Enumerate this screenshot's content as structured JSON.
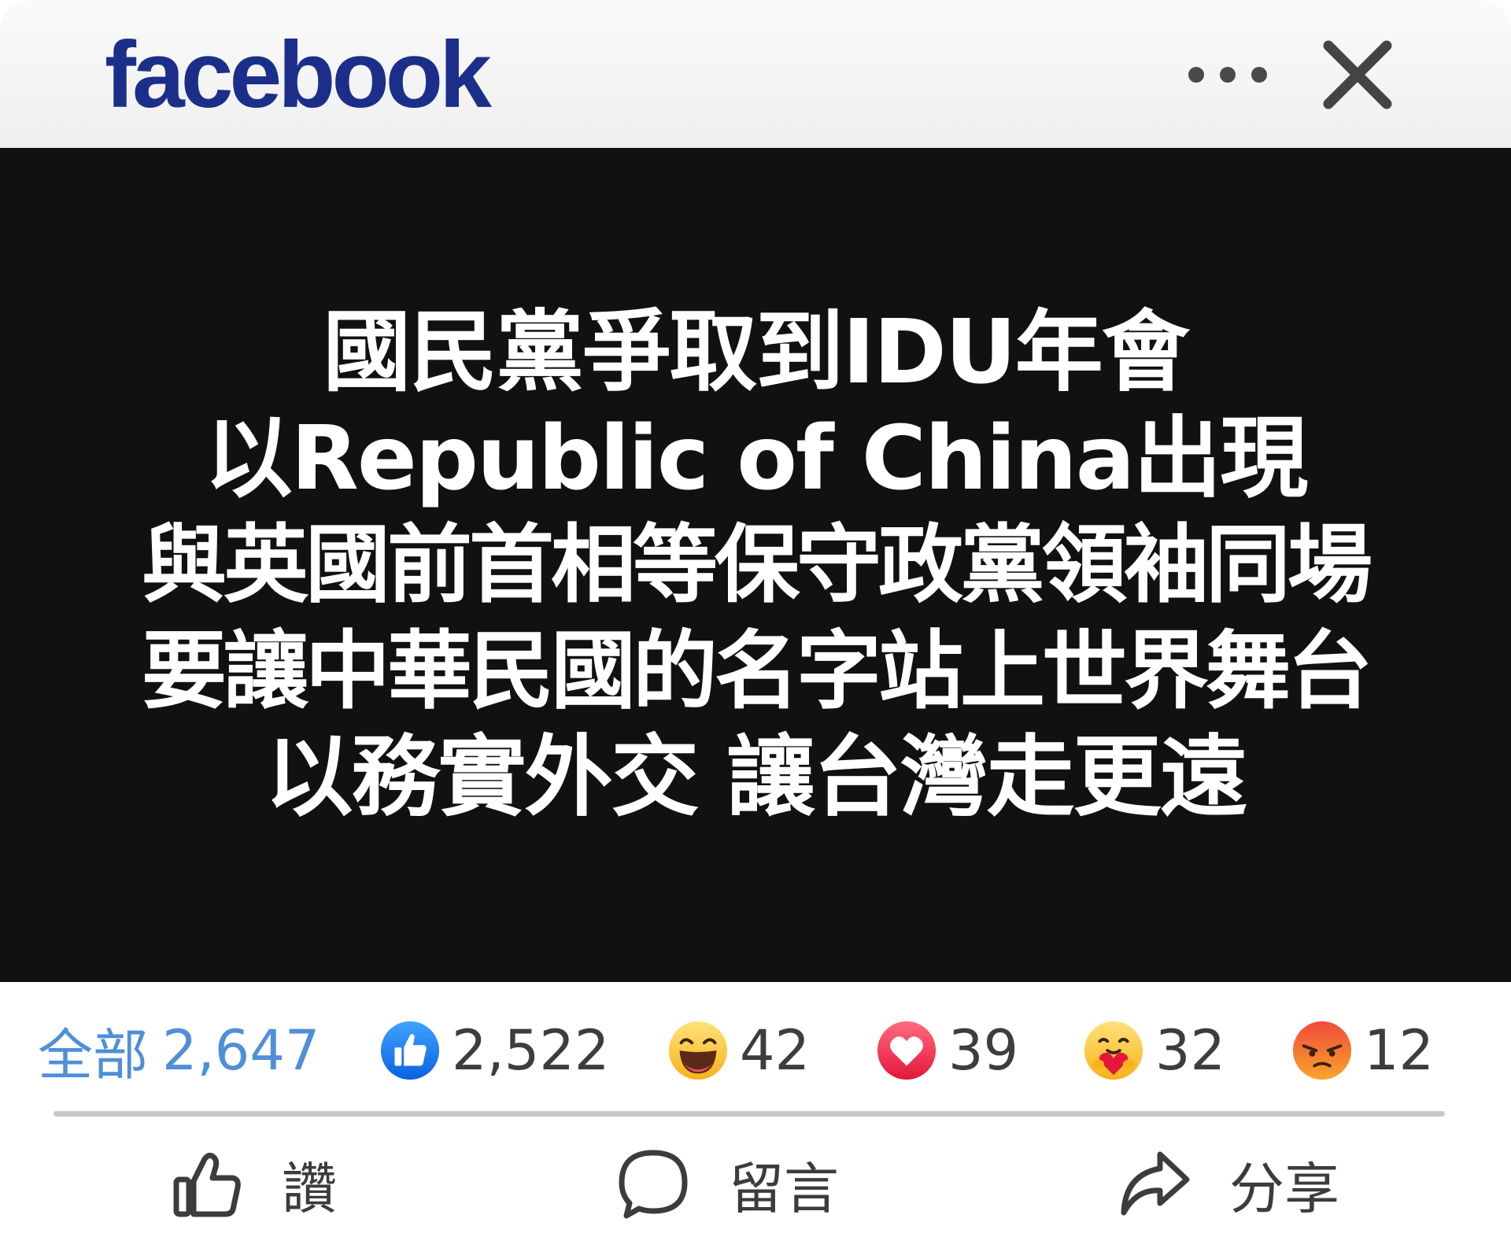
{
  "header": {
    "logo_text": "facebook",
    "more_icon": "more-dots-icon",
    "close_icon": "close-icon",
    "logo_color": "#1b2f8a"
  },
  "post": {
    "background_color": "#111111",
    "text_color": "#ffffff",
    "lines": [
      "國民黨爭取到IDU年會",
      "以Republic of China出現",
      "與英國前首相等保守政黨領袖同場",
      "要讓中華民國的名字站上世界舞台",
      "以務實外交 讓台灣走更遠"
    ]
  },
  "reactions": {
    "all_label": "全部",
    "all_count": "2,647",
    "all_color": "#4f8fd8",
    "items": [
      {
        "icon": "like-reaction-icon",
        "count": "2,522"
      },
      {
        "icon": "haha-reaction-icon",
        "count": "42"
      },
      {
        "icon": "love-reaction-icon",
        "count": "39"
      },
      {
        "icon": "care-reaction-icon",
        "count": "32"
      },
      {
        "icon": "angry-reaction-icon",
        "count": "12"
      }
    ]
  },
  "actions": {
    "like_label": "讚",
    "comment_label": "留言",
    "share_label": "分享",
    "like_icon": "thumbs-up-icon",
    "comment_icon": "comment-bubble-icon",
    "share_icon": "share-arrow-icon"
  }
}
